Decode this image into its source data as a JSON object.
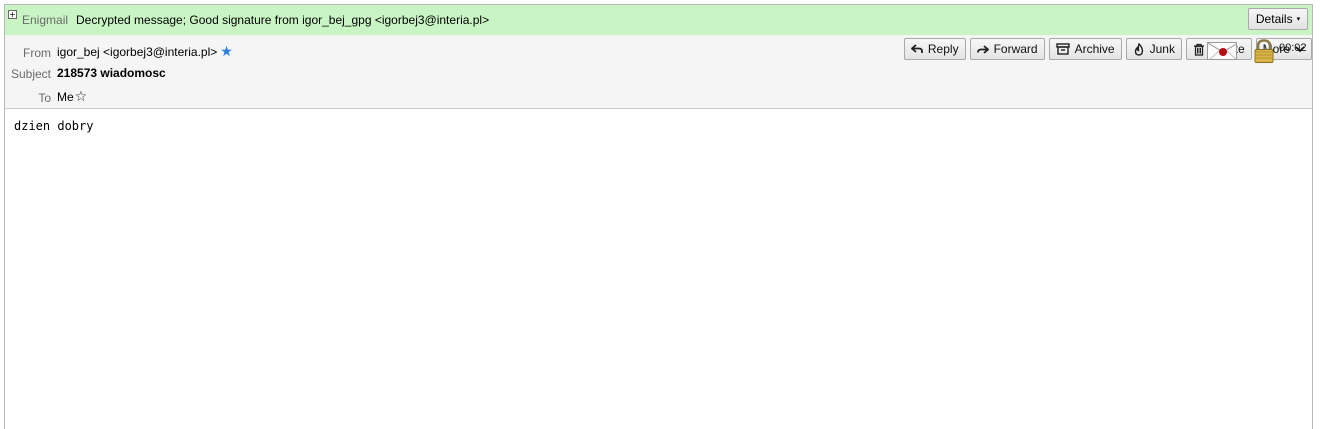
{
  "enigmail": {
    "expander": "+",
    "label": "Enigmail",
    "message": "Decrypted message; Good signature from igor_bej_gpg <igorbej3@interia.pl>",
    "details_label": "Details",
    "details_caret": "▾"
  },
  "header": {
    "from_label": "From",
    "from_value": "igor_bej <igorbej3@interia.pl>",
    "subject_label": "Subject",
    "subject_value": "218573 wiadomosc",
    "to_label": "To",
    "to_value": "Me",
    "time": "00:02"
  },
  "toolbar": {
    "reply": "Reply",
    "forward": "Forward",
    "archive": "Archive",
    "junk": "Junk",
    "delete": "Delete",
    "more": "More"
  },
  "icons": {
    "reply": "reply-arrow-icon",
    "forward": "forward-arrow-icon",
    "archive": "archive-box-icon",
    "junk": "junk-flame-icon",
    "delete": "trash-icon",
    "more": "chevron-down-icon",
    "signed": "sealed-envelope-icon",
    "encrypted": "padlock-icon",
    "from_star": "blue-star-icon",
    "to_star": "outline-star-icon"
  },
  "colors": {
    "enigmail_bar": "#c9f5c5",
    "header_bg": "#f5f5f5",
    "star_blue": "#2b7fd8",
    "seal_red": "#b50f14"
  },
  "body": {
    "text": "dzien dobry"
  }
}
